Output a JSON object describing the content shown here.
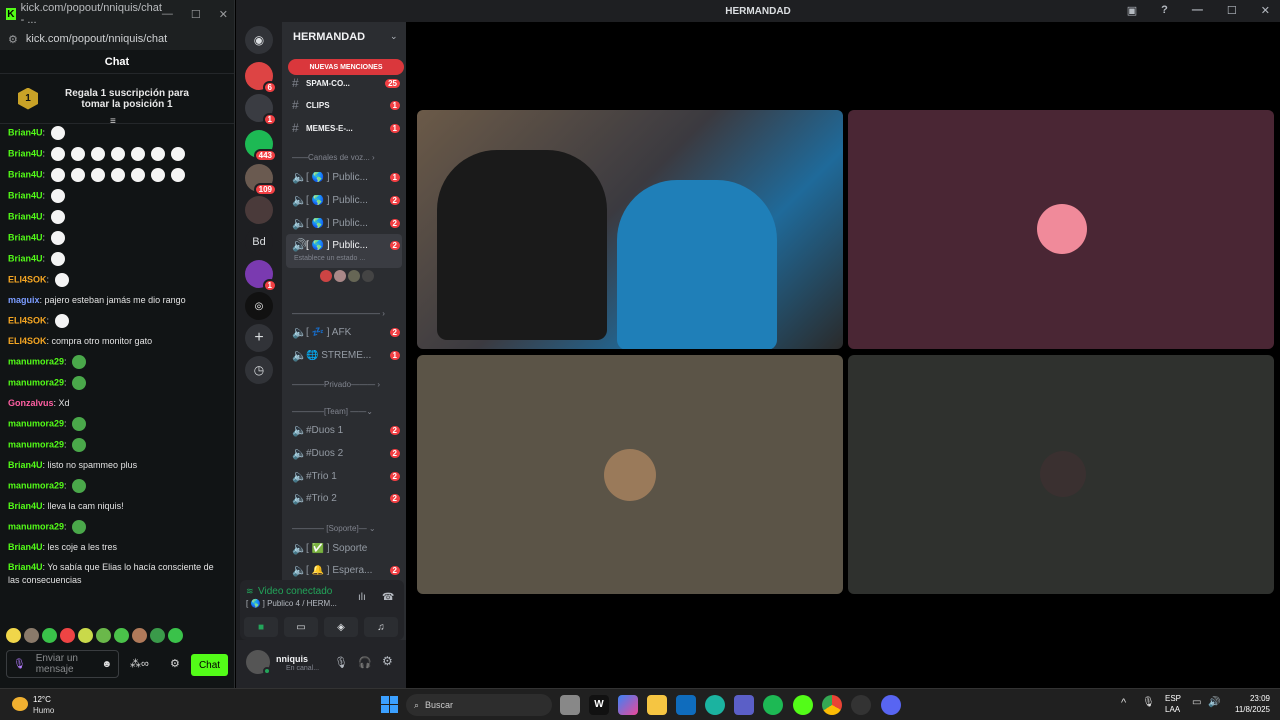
{
  "kick": {
    "window_title": "kick.com/popout/nniquis/chat - ...",
    "url": "kick.com/popout/nniquis/chat",
    "chat_title": "Chat",
    "gift_badge": "1",
    "gift_text": "Regala 1 suscripción para tomar la posición 1",
    "messages": [
      {
        "user": "Brian4U",
        "color": "#53fc18",
        "text": ""
      },
      {
        "user": "Brian4U",
        "color": "#53fc18",
        "text": ""
      },
      {
        "user": "Brian4U",
        "color": "#53fc18",
        "text": ""
      },
      {
        "user": "Brian4U",
        "color": "#53fc18",
        "text": ""
      },
      {
        "user": "Brian4U",
        "color": "#53fc18",
        "text": ""
      },
      {
        "user": "Brian4U",
        "color": "#53fc18",
        "text": ""
      },
      {
        "user": "Brian4U",
        "color": "#53fc18",
        "text": ""
      },
      {
        "user": "ELI4SOK",
        "color": "#f5a623",
        "text": ""
      },
      {
        "user": "maguix",
        "color": "#7b9cff",
        "text": "pajero esteban jamás me dio rango"
      },
      {
        "user": "ELI4SOK",
        "color": "#f5a623",
        "text": ""
      },
      {
        "user": "ELI4SOK",
        "color": "#f5a623",
        "text": "compra otro monitor gato"
      },
      {
        "user": "manumora29",
        "color": "#53fc18",
        "text": ""
      },
      {
        "user": "manumora29",
        "color": "#53fc18",
        "text": ""
      },
      {
        "user": "Gonzalvus",
        "color": "#ff5fa2",
        "text": "Xd"
      },
      {
        "user": "manumora29",
        "color": "#53fc18",
        "text": ""
      },
      {
        "user": "manumora29",
        "color": "#53fc18",
        "text": ""
      },
      {
        "user": "Brian4U",
        "color": "#53fc18",
        "text": "listo no spammeo plus"
      },
      {
        "user": "manumora29",
        "color": "#53fc18",
        "text": ""
      },
      {
        "user": "Brian4U",
        "color": "#53fc18",
        "text": "lleva la cam niquis!"
      },
      {
        "user": "manumora29",
        "color": "#53fc18",
        "text": ""
      },
      {
        "user": "Brian4U",
        "color": "#53fc18",
        "text": "les coje a les tres"
      },
      {
        "user": "Brian4U",
        "color": "#53fc18",
        "text": "Yo sabía que Elias lo hacía consciente de las consecuencias"
      }
    ],
    "input_placeholder": "Enviar un mensaje",
    "send_label": "Chat"
  },
  "discord": {
    "window_title": "HERMANDAD",
    "server_name": "HERMANDAD",
    "mentions_pill": "NUEVAS MENCIONES",
    "server_badges": [
      "6",
      "1",
      "443",
      "109",
      "1"
    ],
    "server_letters": "Bd",
    "text_channels": [
      {
        "name": "SPAM-CO...",
        "count": "25"
      },
      {
        "name": "CLIPS",
        "count": "1"
      },
      {
        "name": "MEMES-E-...",
        "count": "1"
      }
    ],
    "voice_category": "Canales de voz...",
    "voice_channels": [
      {
        "name": "[ 🌎 ] Public...",
        "count": "1"
      },
      {
        "name": "[ 🌎 ] Public...",
        "count": "2"
      },
      {
        "name": "[ 🌎 ] Public...",
        "count": "2"
      },
      {
        "name": "[ 🌎 ] Public...",
        "count": "2"
      }
    ],
    "status_hint": "Establece un estado ...",
    "extra_channels": [
      {
        "name": "[ 💤 ] AFK",
        "count": "2"
      },
      {
        "name": "🌐 STREME...",
        "count": "1"
      }
    ],
    "cat_privado": "Privado",
    "cat_team": "[Team]",
    "team_channels": [
      {
        "name": "#Duos 1",
        "count": "2"
      },
      {
        "name": "#Duos 2",
        "count": "2"
      },
      {
        "name": "#Trio 1",
        "count": "2"
      },
      {
        "name": "#Trio 2",
        "count": "2"
      }
    ],
    "cat_soporte": "[Soporte]",
    "support_channels": [
      {
        "name": "[ ✅ ] Soporte",
        "count": ""
      },
      {
        "name": "[ 🔔 ] Espera...",
        "count": "2"
      }
    ],
    "voice_status": "Video conectado",
    "voice_channel": "[ 🌎 ] Publico 4 / HERM...",
    "username": "nniquis",
    "user_status": "En canal..."
  },
  "taskbar": {
    "weather_temp": "12°C",
    "weather_desc": "Humo",
    "search_placeholder": "Buscar",
    "lang": "ESP",
    "region": "LAA",
    "time": "23:09",
    "date": "11/8/2025"
  }
}
